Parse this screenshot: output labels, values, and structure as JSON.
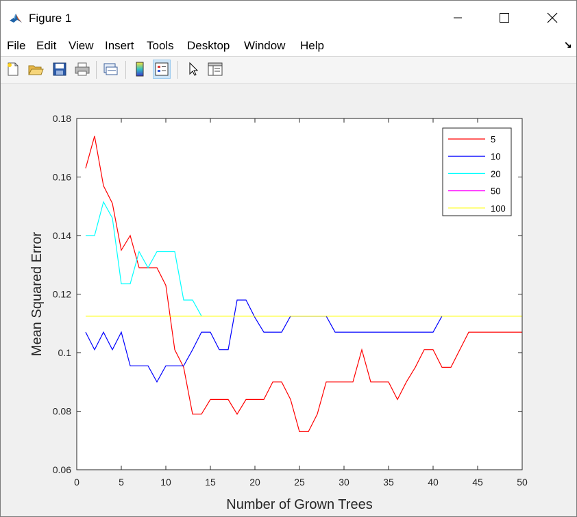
{
  "window": {
    "title": "Figure 1",
    "minimize_icon": "minimize-icon",
    "maximize_icon": "maximize-icon",
    "close_icon": "close-icon"
  },
  "menu": [
    "File",
    "Edit",
    "View",
    "Insert",
    "Tools",
    "Desktop",
    "Window",
    "Help"
  ],
  "dock_icon": "dock-arrow-icon",
  "toolbar": [
    {
      "name": "new-figure-icon"
    },
    {
      "name": "open-file-icon"
    },
    {
      "name": "save-icon"
    },
    {
      "name": "print-icon"
    },
    {
      "name": "link-plot-icon"
    },
    {
      "name": "insert-colorbar-icon"
    },
    {
      "name": "insert-legend-icon",
      "active": true
    },
    {
      "name": "edit-plot-icon"
    },
    {
      "name": "property-inspector-icon"
    }
  ],
  "chart_data": {
    "type": "line",
    "xlabel": "Number of Grown Trees",
    "ylabel": "Mean Squared Error",
    "xlim": [
      0,
      50
    ],
    "ylim": [
      0.06,
      0.18
    ],
    "xticks": [
      "0",
      "5",
      "10",
      "15",
      "20",
      "25",
      "30",
      "35",
      "40",
      "45",
      "50"
    ],
    "yticks": [
      "0.06",
      "0.08",
      "0.1",
      "0.12",
      "0.14",
      "0.16",
      "0.18"
    ],
    "grid": false,
    "legend_position": "top-right",
    "series": [
      {
        "name": "5",
        "color": "#ff0000",
        "x": [
          1,
          2,
          3,
          4,
          5,
          6,
          7,
          8,
          9,
          10,
          11,
          12,
          13,
          14,
          15,
          16,
          17,
          18,
          19,
          20,
          21,
          22,
          23,
          24,
          25,
          26,
          27,
          28,
          29,
          30,
          31,
          32,
          33,
          34,
          35,
          36,
          37,
          38,
          39,
          40,
          41,
          42,
          43,
          44,
          45,
          46,
          47,
          48,
          49,
          50
        ],
        "y": [
          0.163,
          0.174,
          0.157,
          0.151,
          0.135,
          0.14,
          0.129,
          0.129,
          0.129,
          0.123,
          0.101,
          0.095,
          0.079,
          0.079,
          0.084,
          0.084,
          0.084,
          0.079,
          0.084,
          0.084,
          0.084,
          0.09,
          0.09,
          0.084,
          0.073,
          0.073,
          0.079,
          0.09,
          0.09,
          0.09,
          0.09,
          0.101,
          0.09,
          0.09,
          0.09,
          0.084,
          0.09,
          0.095,
          0.101,
          0.101,
          0.095,
          0.095,
          0.101,
          0.107,
          0.107,
          0.107,
          0.107,
          0.107,
          0.107,
          0.107
        ]
      },
      {
        "name": "10",
        "color": "#0000ff",
        "x": [
          1,
          2,
          3,
          4,
          5,
          6,
          7,
          8,
          9,
          10,
          11,
          12,
          13,
          14,
          15,
          16,
          17,
          18,
          19,
          20,
          21,
          22,
          23,
          24,
          25,
          26,
          27,
          28,
          29,
          30,
          31,
          32,
          33,
          34,
          35,
          36,
          37,
          38,
          39,
          40,
          41
        ],
        "y": [
          0.107,
          0.101,
          0.107,
          0.101,
          0.107,
          0.0955,
          0.0955,
          0.0955,
          0.09,
          0.0955,
          0.0955,
          0.0955,
          0.101,
          0.107,
          0.107,
          0.101,
          0.101,
          0.118,
          0.118,
          0.112,
          0.107,
          0.107,
          0.107,
          0.1125,
          0.1125,
          0.1125,
          0.1125,
          0.1125,
          0.107,
          0.107,
          0.107,
          0.107,
          0.107,
          0.107,
          0.107,
          0.107,
          0.107,
          0.107,
          0.107,
          0.107,
          0.1125
        ]
      },
      {
        "name": "20",
        "color": "#00ffff",
        "x": [
          1,
          2,
          3,
          4,
          5,
          6,
          7,
          8,
          9,
          10,
          11,
          12,
          13,
          14
        ],
        "y": [
          0.14,
          0.14,
          0.1515,
          0.146,
          0.1235,
          0.1235,
          0.1345,
          0.129,
          0.1345,
          0.1345,
          0.1345,
          0.118,
          0.118,
          0.1125
        ]
      },
      {
        "name": "50",
        "color": "#ff00ff",
        "x": [],
        "y": []
      },
      {
        "name": "100",
        "color": "#ffff00",
        "x": [
          1,
          50
        ],
        "y": [
          0.1125,
          0.1125
        ]
      }
    ]
  }
}
